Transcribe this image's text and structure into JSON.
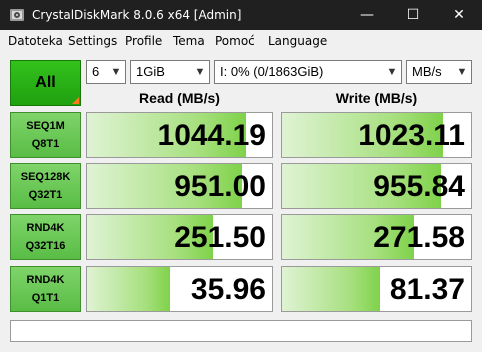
{
  "window": {
    "title": "CrystalDiskMark 8.0.6 x64 [Admin]",
    "minimize_glyph": "—",
    "maximize_glyph": "☐",
    "close_glyph": "✕"
  },
  "menu": {
    "items": [
      {
        "label": "Datoteka"
      },
      {
        "label": "Settings"
      },
      {
        "label": "Profile"
      },
      {
        "label": "Tema"
      },
      {
        "label": "Pomoć"
      },
      {
        "label": "Language"
      }
    ]
  },
  "controls": {
    "all_label": "All",
    "count": "6",
    "size": "1GiB",
    "drive": "I: 0% (0/1863GiB)",
    "unit": "MB/s"
  },
  "columns": {
    "read": "Read (MB/s)",
    "write": "Write (MB/s)"
  },
  "tests": [
    {
      "line1": "SEQ1M",
      "line2": "Q8T1",
      "read": "1044.19",
      "write": "1023.11",
      "read_fill": 0.86,
      "write_fill": 0.85
    },
    {
      "line1": "SEQ128K",
      "line2": "Q32T1",
      "read": "951.00",
      "write": "955.84",
      "read_fill": 0.84,
      "write_fill": 0.84
    },
    {
      "line1": "RND4K",
      "line2": "Q32T16",
      "read": "251.50",
      "write": "271.58",
      "read_fill": 0.68,
      "write_fill": 0.7
    },
    {
      "line1": "RND4K",
      "line2": "Q1T1",
      "read": "35.96",
      "write": "81.37",
      "read_fill": 0.45,
      "write_fill": 0.52
    }
  ],
  "comment": "",
  "colors": {
    "title_bg": "#202020",
    "accent_green": "#20a010",
    "bar_green": "#7fd24a"
  }
}
